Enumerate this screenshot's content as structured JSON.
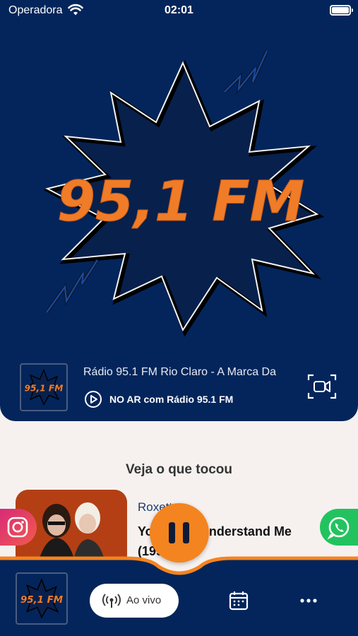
{
  "status_bar": {
    "carrier": "Operadora",
    "time": "02:01"
  },
  "logo": {
    "text": "95,1 FM",
    "brand_orange": "#f07c28",
    "navy": "#03255b"
  },
  "now_playing": {
    "station_title": "Rádio 95.1 FM Rio Claro - A Marca Da",
    "on_air": "NO AR com Rádio 95.1 FM"
  },
  "history": {
    "section_title": "Veja o que tocou",
    "artist": "Roxette",
    "song": "You Don't Understand Me (1995)"
  },
  "bottom_nav": {
    "live_label": "Ao vivo"
  },
  "icons": [
    "wifi-icon",
    "battery-icon",
    "play-circle-icon",
    "video-icon",
    "instagram-icon",
    "whatsapp-icon",
    "pause-icon",
    "radio-icon",
    "calendar-icon",
    "more-icon"
  ]
}
